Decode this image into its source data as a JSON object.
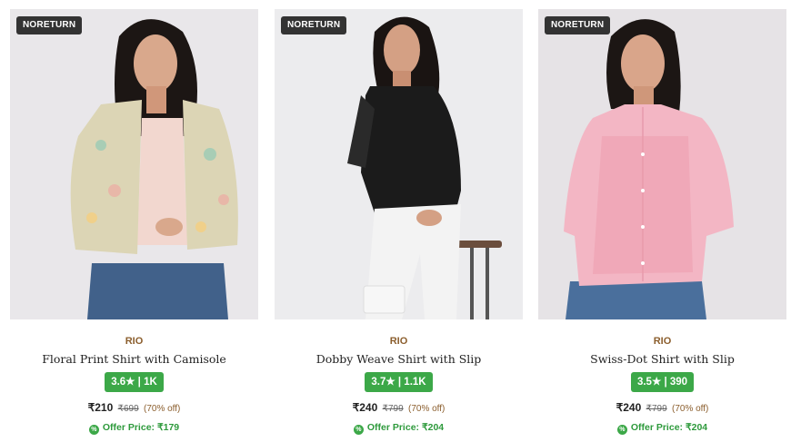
{
  "products": [
    {
      "tag": "NORETURN",
      "brand": "RIO",
      "name": "Floral Print Shirt with Camisole",
      "rating": "3.6★ | 1K",
      "price": "₹210",
      "mrp": "₹699",
      "discount": "(70% off)",
      "offer": "Offer Price: ₹179",
      "image_bg": "#e9e7ea",
      "top_color": "#dcd5b5",
      "inner_color": "#f2d7cf",
      "bottom_color": "#41618a"
    },
    {
      "tag": "NORETURN",
      "brand": "RIO",
      "name": "Dobby Weave Shirt with Slip",
      "rating": "3.7★ | 1.1K",
      "price": "₹240",
      "mrp": "₹799",
      "discount": "(70% off)",
      "offer": "Offer Price: ₹204",
      "image_bg": "#ececee",
      "top_color": "#1b1b1b",
      "inner_color": "#101010",
      "bottom_color": "#f3f3f3"
    },
    {
      "tag": "NORETURN",
      "brand": "RIO",
      "name": "Swiss-Dot Shirt with Slip",
      "rating": "3.5★ | 390",
      "price": "₹240",
      "mrp": "₹799",
      "discount": "(70% off)",
      "offer": "Offer Price: ₹204",
      "image_bg": "#e6e3e6",
      "top_color": "#f3b6c4",
      "inner_color": "#f0a8b8",
      "bottom_color": "#4a6f9c"
    }
  ],
  "colors": {
    "rating_badge": "#3ca848",
    "brand": "#8b5e2d",
    "offer": "#2e9a3c",
    "tag_bg": "#333333"
  }
}
